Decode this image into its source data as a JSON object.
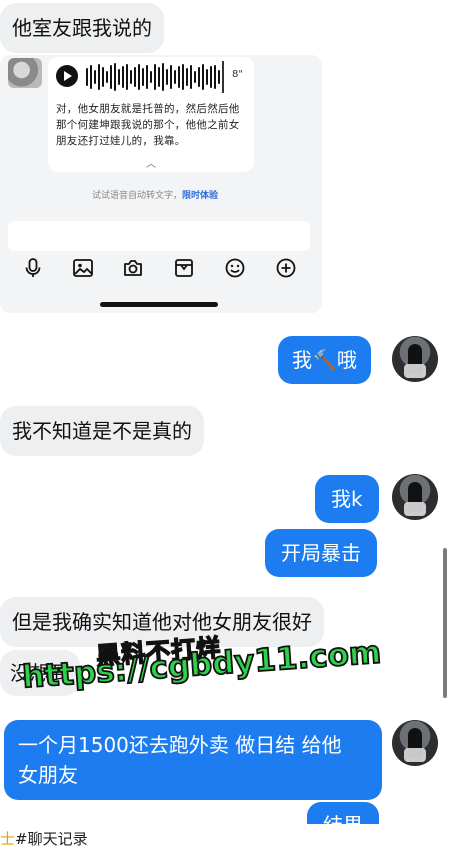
{
  "messages": {
    "m1": "他室友跟我说的",
    "m2": "我🔨哦",
    "m3": "我不知道是不是真的",
    "m4": "我k",
    "m5": "开局暴击",
    "m6": "但是我确实知道他对他女朋友很好",
    "m7": "没想到",
    "m8_line1": "一个月1500还去跑外卖 做日结 给他",
    "m8_line2": "女朋友",
    "m9": "结果"
  },
  "embedded_screenshot": {
    "voice_duration": "8\"",
    "transcript": "对，他女朋友就是托普的，然后然后他那个何建坤跟我说的那个，他他之前女朋友还打过娃儿的，我靠。",
    "hint_text": "试试语音自动转文字，",
    "hint_link": "限时体验",
    "toolbar_icons": [
      "microphone-icon",
      "image-icon",
      "camera-icon",
      "sticker-icon",
      "emoji-icon",
      "plus-icon"
    ]
  },
  "watermark": {
    "line1": "黑料不打烊",
    "line2": "https://cgbdy11.com"
  },
  "footer": {
    "label": "#聊天记录",
    "cut_char": "士"
  },
  "colors": {
    "bubble_blue": "#1d7df0",
    "bubble_gray": "#eeeff1",
    "watermark_green": "#2ed24a"
  }
}
